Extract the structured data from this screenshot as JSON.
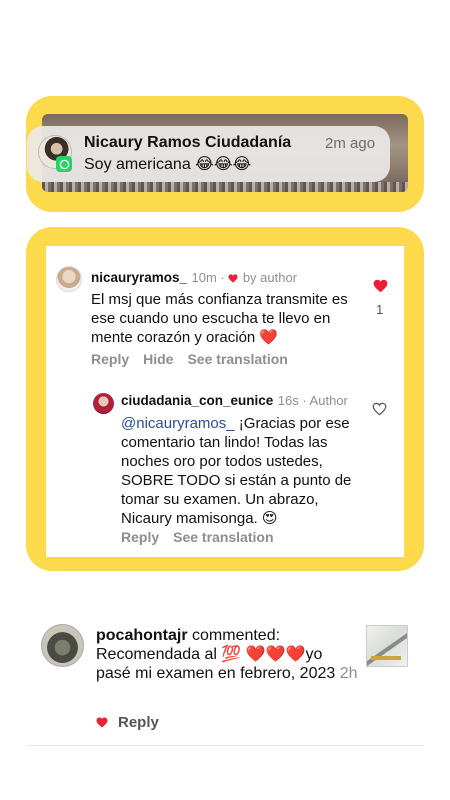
{
  "notification": {
    "title": "Nicaury Ramos Ciudadanía",
    "time": "2m ago",
    "body": "Soy americana 😂😂😂"
  },
  "comment": {
    "username": "nicauryramos_",
    "meta_time": "10m",
    "meta_dot": " · ",
    "meta_by": "by author",
    "text": "El msj que más confianza transmite es ese cuando uno escucha te llevo en mente corazón y oración ❤️",
    "like_count": "1",
    "actions": [
      "Reply",
      "Hide",
      "See translation"
    ]
  },
  "reply": {
    "username": "ciudadania_con_eunice",
    "meta": "16s · Author",
    "mention": "@nicauryramos_",
    "text": " ¡Gracias por ese comentario tan lindo! Todas las noches oro por todos ustedes, SOBRE TODO si están a punto de tomar su examen. Un abrazo, Nicaury mamisonga. 😍",
    "actions": [
      "Reply",
      "See translation"
    ]
  },
  "activity": {
    "username": "pocahontajr",
    "verb": " commented:",
    "text": " Recomendada al 💯 ❤️❤️❤️yo pasé mi examen en febrero, 2023",
    "time": " 2h",
    "reply_label": "Reply"
  },
  "colors": {
    "highlight": "#fdd94c",
    "like_red": "#ed1f37",
    "link_blue": "#2a4e9a",
    "whatsapp_green": "#25d366"
  }
}
